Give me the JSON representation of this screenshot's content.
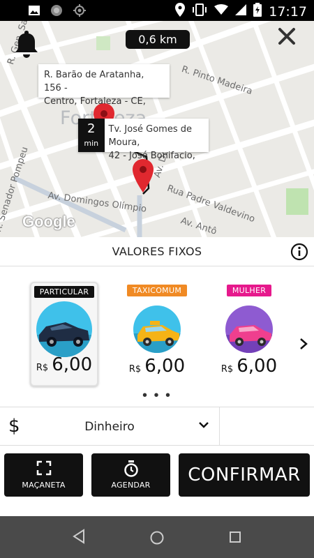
{
  "status_bar": {
    "time": "17:17"
  },
  "map": {
    "distance": "0,6 km",
    "city_label": "Fortaleza",
    "google_logo": "Google",
    "origin": {
      "address_line1": "R. Barão de Aratanha, 156 -",
      "address_line2": "Centro, Fortaleza - CE,"
    },
    "destination": {
      "minutes": "2",
      "minutes_unit": "min",
      "address_line1": "Tv. José Gomes de Moura,",
      "address_line2": "42 - José Bonifacio,"
    },
    "streets": {
      "cen_sampaio": "R. Gen. Sampaio",
      "pinto_madeira": "R. Pinto Madeira",
      "senador_pompeu": "R. Senador Pompeu",
      "domingos_olimpio": "Av. Domingos Olímpio",
      "padre_valdevino": "Rua Padre Valdevino",
      "av_dom": "Av. Dom",
      "av_anto": "Av. Antô"
    }
  },
  "fixed_values": {
    "title": "VALORES FIXOS",
    "options": [
      {
        "badge": "PARTICULAR",
        "badge_color": "#111111",
        "currency": "R$",
        "price": "6,00",
        "selected": true
      },
      {
        "badge": "TAXICOMUM",
        "badge_color": "#f08a24",
        "currency": "R$",
        "price": "6,00",
        "selected": false
      },
      {
        "badge": "MULHER",
        "badge_color": "#e6198c",
        "currency": "R$",
        "price": "6,00",
        "selected": false
      }
    ],
    "pager": "• • •"
  },
  "payment": {
    "symbol": "$",
    "method": "Dinheiro"
  },
  "actions": {
    "door_label": "MAÇANETA",
    "schedule_label": "AGENDAR",
    "confirm_label": "CONFIRMAR"
  }
}
